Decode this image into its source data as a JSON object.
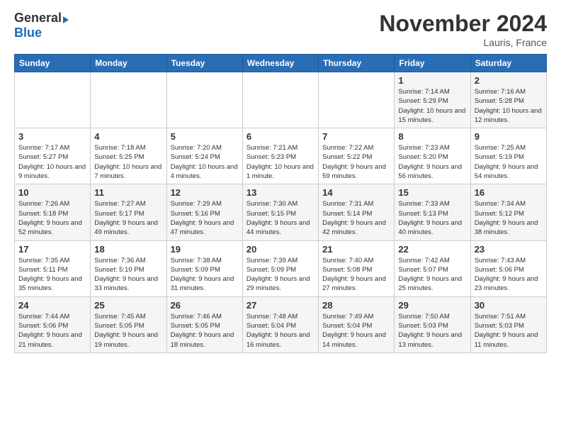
{
  "logo": {
    "general": "General",
    "blue": "Blue"
  },
  "header": {
    "month": "November 2024",
    "location": "Lauris, France"
  },
  "weekdays": [
    "Sunday",
    "Monday",
    "Tuesday",
    "Wednesday",
    "Thursday",
    "Friday",
    "Saturday"
  ],
  "weeks": [
    [
      {
        "day": "",
        "info": ""
      },
      {
        "day": "",
        "info": ""
      },
      {
        "day": "",
        "info": ""
      },
      {
        "day": "",
        "info": ""
      },
      {
        "day": "",
        "info": ""
      },
      {
        "day": "1",
        "info": "Sunrise: 7:14 AM\nSunset: 5:29 PM\nDaylight: 10 hours and 15 minutes."
      },
      {
        "day": "2",
        "info": "Sunrise: 7:16 AM\nSunset: 5:28 PM\nDaylight: 10 hours and 12 minutes."
      }
    ],
    [
      {
        "day": "3",
        "info": "Sunrise: 7:17 AM\nSunset: 5:27 PM\nDaylight: 10 hours and 9 minutes."
      },
      {
        "day": "4",
        "info": "Sunrise: 7:18 AM\nSunset: 5:25 PM\nDaylight: 10 hours and 7 minutes."
      },
      {
        "day": "5",
        "info": "Sunrise: 7:20 AM\nSunset: 5:24 PM\nDaylight: 10 hours and 4 minutes."
      },
      {
        "day": "6",
        "info": "Sunrise: 7:21 AM\nSunset: 5:23 PM\nDaylight: 10 hours and 1 minute."
      },
      {
        "day": "7",
        "info": "Sunrise: 7:22 AM\nSunset: 5:22 PM\nDaylight: 9 hours and 59 minutes."
      },
      {
        "day": "8",
        "info": "Sunrise: 7:23 AM\nSunset: 5:20 PM\nDaylight: 9 hours and 56 minutes."
      },
      {
        "day": "9",
        "info": "Sunrise: 7:25 AM\nSunset: 5:19 PM\nDaylight: 9 hours and 54 minutes."
      }
    ],
    [
      {
        "day": "10",
        "info": "Sunrise: 7:26 AM\nSunset: 5:18 PM\nDaylight: 9 hours and 52 minutes."
      },
      {
        "day": "11",
        "info": "Sunrise: 7:27 AM\nSunset: 5:17 PM\nDaylight: 9 hours and 49 minutes."
      },
      {
        "day": "12",
        "info": "Sunrise: 7:29 AM\nSunset: 5:16 PM\nDaylight: 9 hours and 47 minutes."
      },
      {
        "day": "13",
        "info": "Sunrise: 7:30 AM\nSunset: 5:15 PM\nDaylight: 9 hours and 44 minutes."
      },
      {
        "day": "14",
        "info": "Sunrise: 7:31 AM\nSunset: 5:14 PM\nDaylight: 9 hours and 42 minutes."
      },
      {
        "day": "15",
        "info": "Sunrise: 7:33 AM\nSunset: 5:13 PM\nDaylight: 9 hours and 40 minutes."
      },
      {
        "day": "16",
        "info": "Sunrise: 7:34 AM\nSunset: 5:12 PM\nDaylight: 9 hours and 38 minutes."
      }
    ],
    [
      {
        "day": "17",
        "info": "Sunrise: 7:35 AM\nSunset: 5:11 PM\nDaylight: 9 hours and 35 minutes."
      },
      {
        "day": "18",
        "info": "Sunrise: 7:36 AM\nSunset: 5:10 PM\nDaylight: 9 hours and 33 minutes."
      },
      {
        "day": "19",
        "info": "Sunrise: 7:38 AM\nSunset: 5:09 PM\nDaylight: 9 hours and 31 minutes."
      },
      {
        "day": "20",
        "info": "Sunrise: 7:39 AM\nSunset: 5:09 PM\nDaylight: 9 hours and 29 minutes."
      },
      {
        "day": "21",
        "info": "Sunrise: 7:40 AM\nSunset: 5:08 PM\nDaylight: 9 hours and 27 minutes."
      },
      {
        "day": "22",
        "info": "Sunrise: 7:42 AM\nSunset: 5:07 PM\nDaylight: 9 hours and 25 minutes."
      },
      {
        "day": "23",
        "info": "Sunrise: 7:43 AM\nSunset: 5:06 PM\nDaylight: 9 hours and 23 minutes."
      }
    ],
    [
      {
        "day": "24",
        "info": "Sunrise: 7:44 AM\nSunset: 5:06 PM\nDaylight: 9 hours and 21 minutes."
      },
      {
        "day": "25",
        "info": "Sunrise: 7:45 AM\nSunset: 5:05 PM\nDaylight: 9 hours and 19 minutes."
      },
      {
        "day": "26",
        "info": "Sunrise: 7:46 AM\nSunset: 5:05 PM\nDaylight: 9 hours and 18 minutes."
      },
      {
        "day": "27",
        "info": "Sunrise: 7:48 AM\nSunset: 5:04 PM\nDaylight: 9 hours and 16 minutes."
      },
      {
        "day": "28",
        "info": "Sunrise: 7:49 AM\nSunset: 5:04 PM\nDaylight: 9 hours and 14 minutes."
      },
      {
        "day": "29",
        "info": "Sunrise: 7:50 AM\nSunset: 5:03 PM\nDaylight: 9 hours and 13 minutes."
      },
      {
        "day": "30",
        "info": "Sunrise: 7:51 AM\nSunset: 5:03 PM\nDaylight: 9 hours and 11 minutes."
      }
    ]
  ]
}
